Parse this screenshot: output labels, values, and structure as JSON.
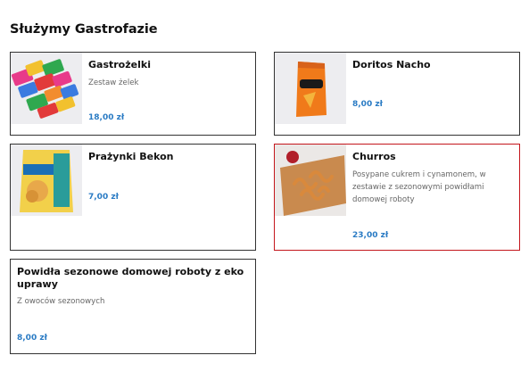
{
  "section": {
    "title": "Służymy Gastrofazie"
  },
  "products": [
    {
      "name": "Gastrożelki",
      "description": "Zestaw żelek",
      "price": "18,00 zł",
      "thumb_icon": "gummy-candies-image"
    },
    {
      "name": "Doritos Nacho",
      "description": "",
      "price": "8,00 zł",
      "thumb_icon": "doritos-bag-image"
    },
    {
      "name": "Prażynki Bekon",
      "description": "",
      "price": "7,00 zł",
      "thumb_icon": "chips-bag-image"
    },
    {
      "name": "Churros",
      "description": "Posypane cukrem i cynamonem, w zestawie z sezonowymi powidłami domowej roboty",
      "price": "23,00 zł",
      "thumb_icon": "churros-board-image",
      "selected": true
    },
    {
      "name": "Powidła sezonowe domowej roboty z eko uprawy",
      "description": "Z owoców sezonowych",
      "price": "8,00 zł",
      "thumb_icon": ""
    }
  ],
  "colors": {
    "price": "#2a7bc4",
    "selected_border": "#c4161c",
    "border": "#333333"
  }
}
